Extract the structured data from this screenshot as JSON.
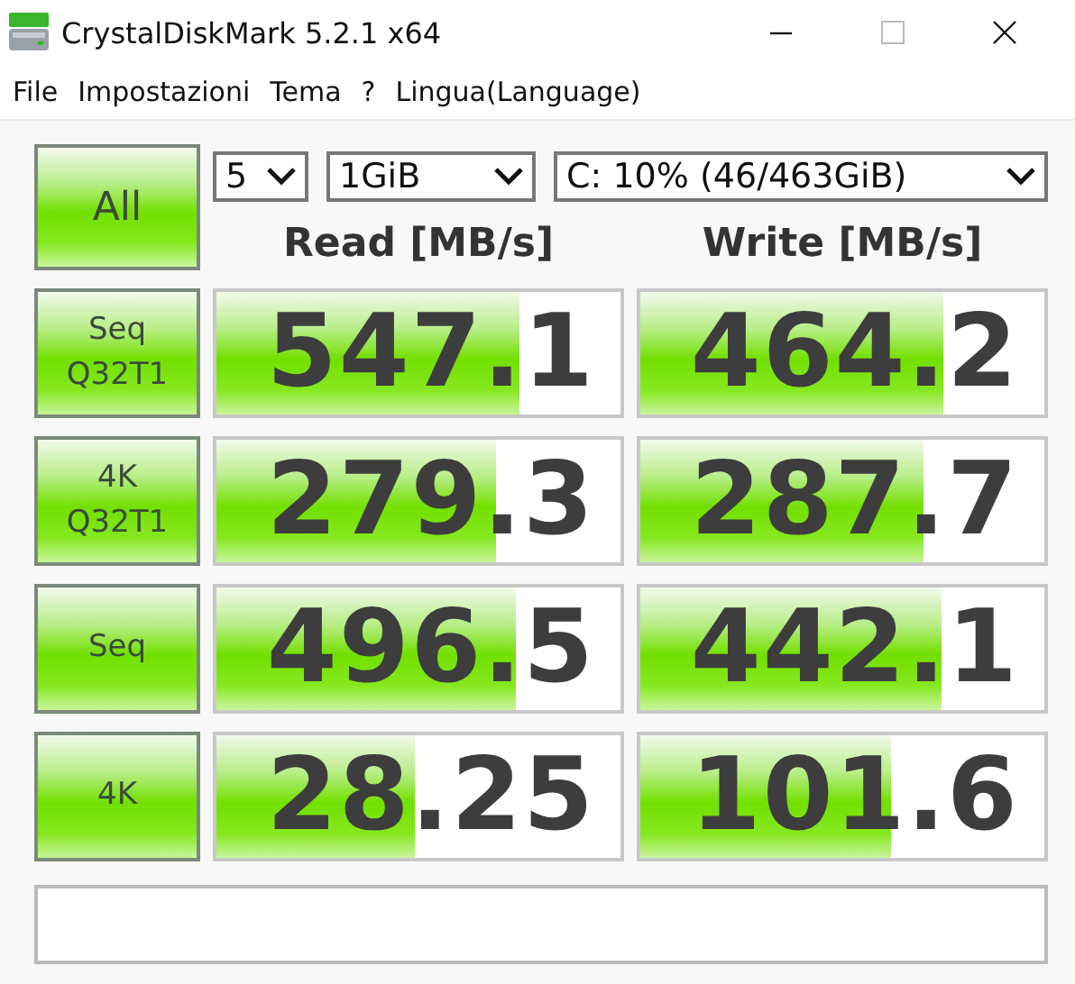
{
  "window": {
    "title": "CrystalDiskMark 5.2.1 x64"
  },
  "menu": [
    "File",
    "Impostazioni",
    "Tema",
    "?",
    "Lingua(Language)"
  ],
  "controls": {
    "all_button": "All",
    "count": "5",
    "size": "1GiB",
    "drive": "C: 10% (46/463GiB)"
  },
  "headers": {
    "read": "Read [MB/s]",
    "write": "Write [MB/s]"
  },
  "tests": [
    {
      "label": "Seq Q32T1",
      "read": {
        "value": "547.1",
        "level": 0.75
      },
      "write": {
        "value": "464.2",
        "level": 0.75
      }
    },
    {
      "label": "4K Q32T1",
      "read": {
        "value": "279.3",
        "level": 0.69
      },
      "write": {
        "value": "287.7",
        "level": 0.7
      }
    },
    {
      "label": "Seq",
      "read": {
        "value": "496.5",
        "level": 0.74
      },
      "write": {
        "value": "442.1",
        "level": 0.745
      }
    },
    {
      "label": "4K",
      "read": {
        "value": "28.25",
        "level": 0.49
      },
      "write": {
        "value": "101.6",
        "level": 0.62
      }
    }
  ]
}
